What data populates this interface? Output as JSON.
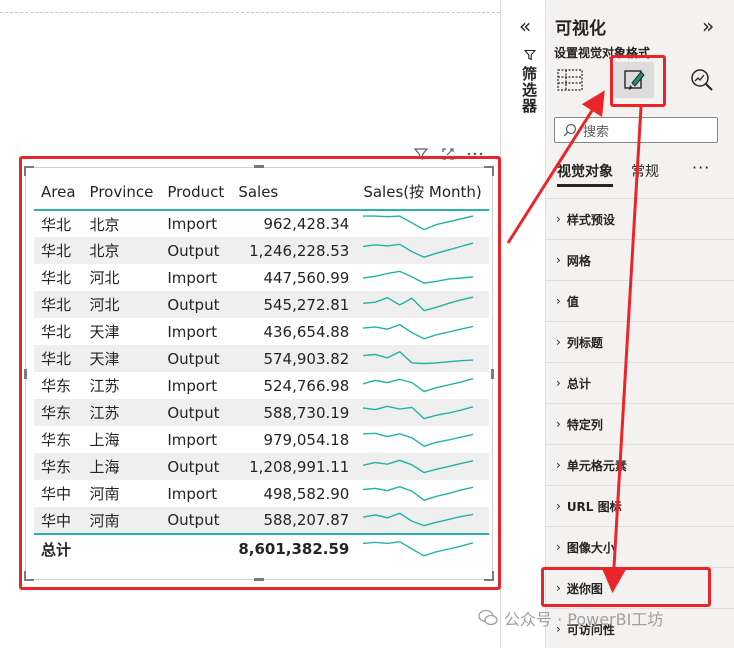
{
  "table": {
    "headers": [
      "Area",
      "Province",
      "Product",
      "Sales",
      "Sales(按 Month)"
    ],
    "rows": [
      {
        "area": "华北",
        "province": "北京",
        "product": "Import",
        "sales": "962,428.34",
        "spark": [
          3,
          3,
          2.9,
          3,
          1.8,
          0.6,
          1.5,
          2,
          2.5,
          3
        ]
      },
      {
        "area": "华北",
        "province": "北京",
        "product": "Output",
        "sales": "1,246,228.53",
        "spark": [
          2.4,
          2.7,
          2.5,
          2.8,
          1.5,
          0.5,
          1.2,
          1.8,
          2.4,
          3
        ]
      },
      {
        "area": "华北",
        "province": "河北",
        "product": "Import",
        "sales": "447,560.99",
        "spark": [
          1.6,
          1.9,
          2.4,
          2.8,
          1.8,
          0.7,
          1,
          1.4,
          1.6,
          1.8
        ]
      },
      {
        "area": "华北",
        "province": "河北",
        "product": "Output",
        "sales": "545,272.81",
        "spark": [
          1.9,
          2.1,
          2.9,
          1.6,
          2.8,
          0.6,
          1.2,
          1.9,
          2.5,
          3
        ]
      },
      {
        "area": "华北",
        "province": "天津",
        "product": "Import",
        "sales": "436,654.88",
        "spark": [
          2.3,
          2.5,
          2.1,
          2.9,
          1.5,
          0.4,
          1.1,
          1.6,
          2.1,
          2.6
        ]
      },
      {
        "area": "华北",
        "province": "天津",
        "product": "Output",
        "sales": "574,903.82",
        "spark": [
          2.2,
          2.4,
          1.8,
          2.9,
          0.9,
          0.8,
          0.9,
          1.1,
          1.3,
          1.4
        ]
      },
      {
        "area": "华东",
        "province": "江苏",
        "product": "Import",
        "sales": "524,766.98",
        "spark": [
          2,
          2.6,
          2.2,
          2.8,
          2.2,
          0.6,
          1.3,
          1.8,
          2.3,
          2.9
        ]
      },
      {
        "area": "华东",
        "province": "江苏",
        "product": "Output",
        "sales": "588,730.19",
        "spark": [
          2.5,
          2.2,
          2.8,
          2.3,
          2.6,
          0.6,
          1.2,
          1.6,
          2.1,
          2.7
        ]
      },
      {
        "area": "华东",
        "province": "上海",
        "product": "Import",
        "sales": "979,054.18",
        "spark": [
          2.7,
          2.8,
          2.2,
          2.7,
          2,
          0.5,
          1.2,
          1.6,
          2.1,
          2.6
        ]
      },
      {
        "area": "华东",
        "province": "上海",
        "product": "Output",
        "sales": "1,208,991.11",
        "spark": [
          1.9,
          2.4,
          2.1,
          2.8,
          2,
          0.6,
          1.2,
          1.7,
          2.2,
          2.7
        ]
      },
      {
        "area": "华中",
        "province": "河南",
        "product": "Import",
        "sales": "498,582.90",
        "spark": [
          2.4,
          2.6,
          2.2,
          2.9,
          2.1,
          0.5,
          1.2,
          1.7,
          2.3,
          2.8
        ]
      },
      {
        "area": "华中",
        "province": "河南",
        "product": "Output",
        "sales": "588,207.87",
        "spark": [
          2.1,
          2.5,
          2,
          2.8,
          1.4,
          0.6,
          1.2,
          1.7,
          2.2,
          2.6
        ]
      }
    ],
    "total": {
      "label": "总计",
      "sales": "8,601,382.59",
      "spark": [
        2.6,
        2.8,
        2.6,
        2.9,
        1.6,
        0.4,
        1.1,
        1.6,
        2.1,
        2.7
      ]
    }
  },
  "filter_rail": {
    "label": "筛选器"
  },
  "viz": {
    "title": "可视化",
    "subtitle": "设置视觉对象格式",
    "search_placeholder": "搜索",
    "tabs": [
      "视觉对象",
      "常规"
    ],
    "more": "···",
    "sections": [
      "样式预设",
      "网格",
      "值",
      "列标题",
      "总计",
      "特定列",
      "单元格元素",
      "URL 图标",
      "图像大小",
      "迷你图",
      "可访问性"
    ]
  },
  "colors": {
    "accent": "#2ab4a9",
    "highlight": "#e8262a",
    "spark": "#23b2a6"
  },
  "watermark": "公众号 · PowerBI工坊"
}
